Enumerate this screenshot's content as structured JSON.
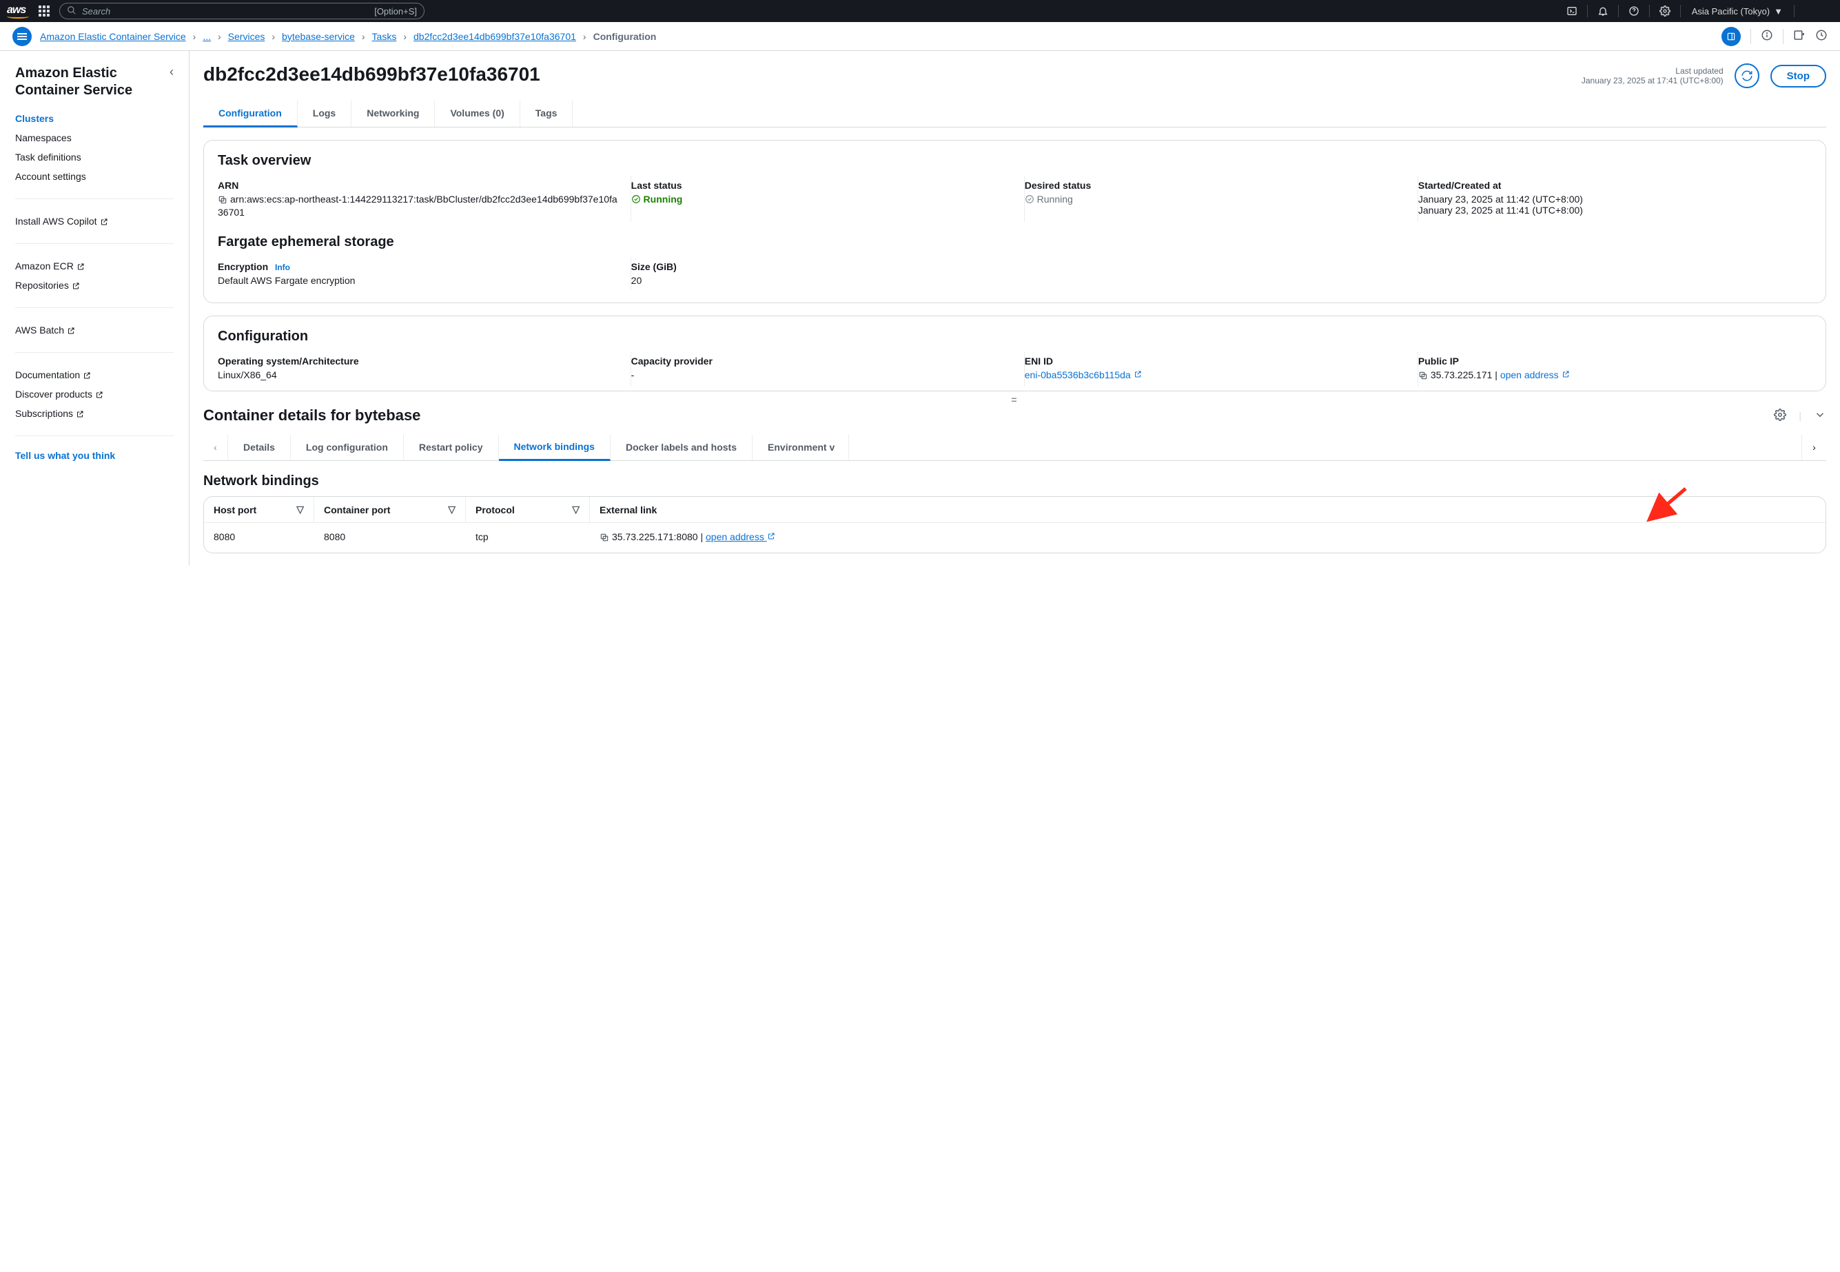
{
  "topnav": {
    "logo": "aws",
    "search_placeholder": "Search",
    "search_hint": "[Option+S]",
    "region": "Asia Pacific (Tokyo)"
  },
  "breadcrumbs": {
    "items": [
      "Amazon Elastic Container Service",
      "...",
      "Services",
      "bytebase-service",
      "Tasks",
      "db2fcc2d3ee14db699bf37e10fa36701"
    ],
    "current": "Configuration"
  },
  "sidebar": {
    "title": "Amazon Elastic Container Service",
    "nav": [
      "Clusters",
      "Namespaces",
      "Task definitions",
      "Account settings"
    ],
    "group2": [
      "Install AWS Copilot"
    ],
    "group3": [
      "Amazon ECR",
      "Repositories"
    ],
    "group4": [
      "AWS Batch"
    ],
    "group5": [
      "Documentation",
      "Discover products",
      "Subscriptions"
    ],
    "feedback": "Tell us what you think"
  },
  "page": {
    "title": "db2fcc2d3ee14db699bf37e10fa36701",
    "last_updated_label": "Last updated",
    "last_updated_value": "January 23, 2025 at 17:41 (UTC+8:00)",
    "stop_label": "Stop"
  },
  "tabs": [
    "Configuration",
    "Logs",
    "Networking",
    "Volumes (0)",
    "Tags"
  ],
  "overview": {
    "heading": "Task overview",
    "arn_label": "ARN",
    "arn_value": "arn:aws:ecs:ap-northeast-1:144229113217:task/BbCluster/db2fcc2d3ee14db699bf37e10fa36701",
    "last_status_label": "Last status",
    "last_status_value": "Running",
    "desired_status_label": "Desired status",
    "desired_status_value": "Running",
    "started_label": "Started/Created at",
    "started_value1": "January 23, 2025 at 11:42 (UTC+8:00)",
    "started_value2": "January 23, 2025 at 11:41 (UTC+8:00)"
  },
  "storage": {
    "heading": "Fargate ephemeral storage",
    "encryption_label": "Encryption",
    "info": "Info",
    "encryption_value": "Default AWS Fargate encryption",
    "size_label": "Size (GiB)",
    "size_value": "20"
  },
  "config": {
    "heading": "Configuration",
    "os_label": "Operating system/Architecture",
    "os_value": "Linux/X86_64",
    "cap_label": "Capacity provider",
    "cap_value": "-",
    "eni_label": "ENI ID",
    "eni_value": "eni-0ba5536b3c6b115da",
    "pubip_label": "Public IP",
    "pubip_value": "35.73.225.171",
    "open_address": "open address"
  },
  "container": {
    "heading": "Container details for bytebase",
    "tabs": [
      "Details",
      "Log configuration",
      "Restart policy",
      "Network bindings",
      "Docker labels and hosts",
      "Environment v"
    ],
    "nb_heading": "Network bindings",
    "columns": [
      "Host port",
      "Container port",
      "Protocol",
      "External link"
    ],
    "row": {
      "host_port": "8080",
      "container_port": "8080",
      "protocol": "tcp",
      "external_ip": "35.73.225.171:8080",
      "open_address": "open address"
    }
  }
}
